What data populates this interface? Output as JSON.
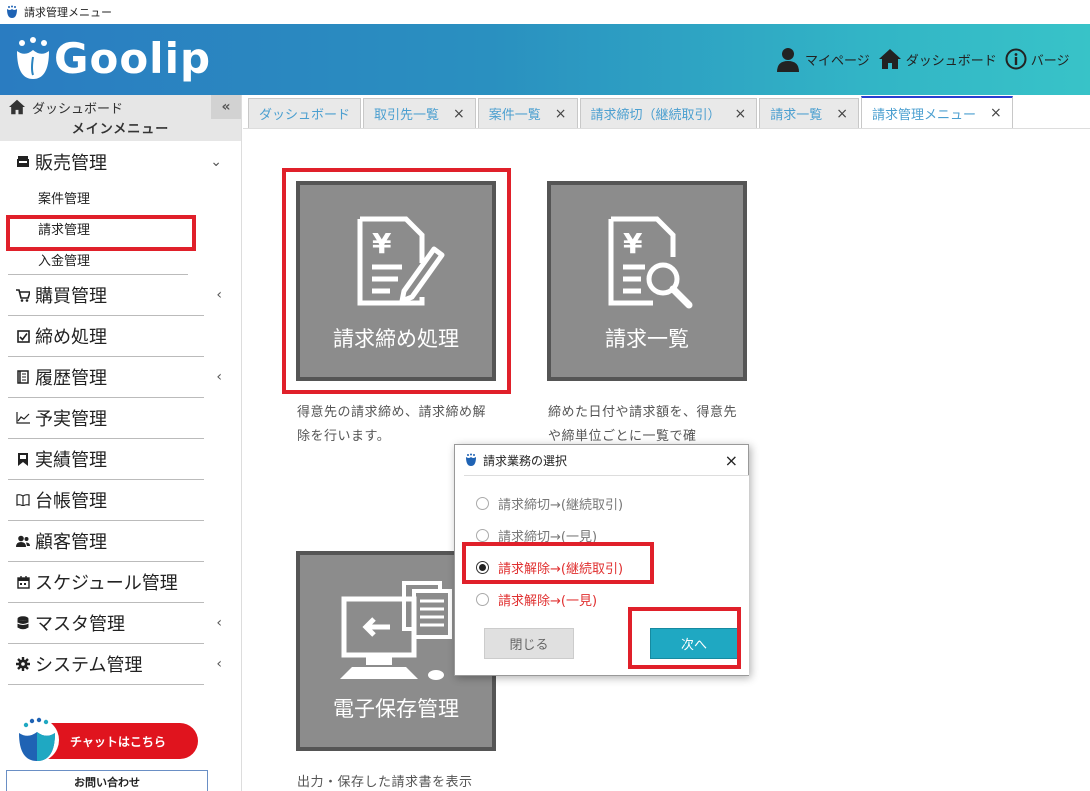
{
  "window": {
    "title": "請求管理メニュー"
  },
  "header": {
    "logo_text": "Goolip",
    "nav": [
      {
        "label": "マイページ",
        "icon": "user-icon"
      },
      {
        "label": "ダッシュボード",
        "icon": "home-icon"
      },
      {
        "label": "バージ",
        "icon": "info-icon"
      }
    ]
  },
  "sidebar": {
    "dashboard_label": "ダッシュボード",
    "collapse_label": "«",
    "main_menu_label": "メインメニュー",
    "items": [
      {
        "label": "販売管理",
        "icon": "register-icon",
        "chevron": "⌄",
        "sub": [
          "案件管理",
          "請求管理",
          "入金管理"
        ]
      },
      {
        "label": "購買管理",
        "icon": "cart-icon",
        "chevron": "‹"
      },
      {
        "label": "締め処理",
        "icon": "checkbox-icon",
        "chevron": ""
      },
      {
        "label": "履歴管理",
        "icon": "book-icon",
        "chevron": "‹"
      },
      {
        "label": "予実管理",
        "icon": "chart-icon",
        "chevron": ""
      },
      {
        "label": "実績管理",
        "icon": "bookmark-icon",
        "chevron": ""
      },
      {
        "label": "台帳管理",
        "icon": "open-book-icon",
        "chevron": ""
      },
      {
        "label": "顧客管理",
        "icon": "people-icon",
        "chevron": ""
      },
      {
        "label": "スケジュール管理",
        "icon": "calendar-icon",
        "chevron": ""
      },
      {
        "label": "マスタ管理",
        "icon": "database-icon",
        "chevron": "‹"
      },
      {
        "label": "システム管理",
        "icon": "gear-icon",
        "chevron": "‹"
      }
    ],
    "chat_label": "チャットはこちら",
    "contact_label": "お問い合わせ"
  },
  "tabs": [
    {
      "label": "ダッシュボード",
      "closable": false,
      "active": false
    },
    {
      "label": "取引先一覧",
      "closable": true,
      "active": false
    },
    {
      "label": "案件一覧",
      "closable": true,
      "active": false
    },
    {
      "label": "請求締切（継続取引）",
      "closable": true,
      "active": false
    },
    {
      "label": "請求一覧",
      "closable": true,
      "active": false
    },
    {
      "label": "請求管理メニュー",
      "closable": true,
      "active": true
    }
  ],
  "tab_close_glyph": "×",
  "tiles": [
    {
      "label": "請求締め処理",
      "desc": "得意先の請求締め、請求締め解除を行います。"
    },
    {
      "label": "請求一覧",
      "desc": "締めた日付や請求額を、得意先や締単位ごとに一覧で確"
    },
    {
      "label": "電子保存管理",
      "desc": "出力・保存した請求書を表示"
    }
  ],
  "dialog": {
    "title": "請求業務の選択",
    "close_glyph": "×",
    "options": [
      {
        "label": "請求締切→(継続取引)",
        "selected": false,
        "red": false
      },
      {
        "label": "請求締切→(一見)",
        "selected": false,
        "red": false
      },
      {
        "label": "請求解除→(継続取引)",
        "selected": true,
        "red": true
      },
      {
        "label": "請求解除→(一見)",
        "selected": false,
        "red": true
      }
    ],
    "close_button": "閉じる",
    "next_button": "次へ"
  },
  "colors": {
    "accent_red": "#e0202a",
    "next_button": "#1fa8c2",
    "tile_bg": "#8c8c8c"
  }
}
